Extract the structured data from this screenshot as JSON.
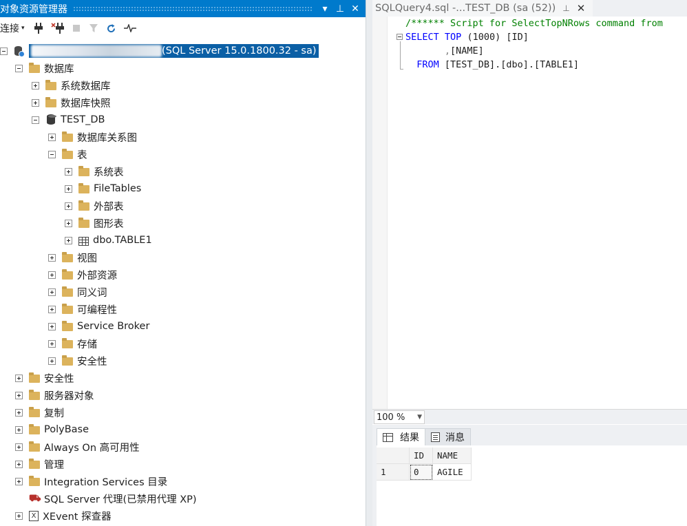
{
  "object_explorer": {
    "title": "对象资源管理器",
    "title_buttons": {
      "dropdown": "▾",
      "pin": "⊥",
      "close": "✕"
    },
    "toolbar": {
      "connect_label": "连接"
    },
    "server_suffix": "(SQL Server 15.0.1800.32 - sa)",
    "tree": {
      "databases": "数据库",
      "system_databases": "系统数据库",
      "database_snapshots": "数据库快照",
      "test_db": "TEST_DB",
      "db_diagrams": "数据库关系图",
      "tables": "表",
      "system_tables": "系统表",
      "filetables": "FileTables",
      "external_tables": "外部表",
      "graph_tables": "图形表",
      "table1": "dbo.TABLE1",
      "views": "视图",
      "external_resources": "外部资源",
      "synonyms": "同义词",
      "programmability": "可编程性",
      "service_broker": "Service Broker",
      "storage": "存储",
      "db_security": "安全性",
      "security": "安全性",
      "server_objects": "服务器对象",
      "replication": "复制",
      "polybase": "PolyBase",
      "always_on": "Always On 高可用性",
      "management": "管理",
      "integration_services": "Integration Services 目录",
      "sql_agent": "SQL Server 代理(已禁用代理 XP)",
      "xevent": "XEvent 探查器"
    }
  },
  "document": {
    "tab_title": "SQLQuery4.sql -...TEST_DB (sa (52))",
    "tab_pin": "⊥",
    "tab_close": "✕",
    "code": {
      "l1_comment": "/****** Script for SelectTopNRows command from",
      "l2_select": "SELECT",
      "l2_top": "TOP",
      "l2_paren": "(1000)",
      "l2_id": "[ID]",
      "l3_comma": ",",
      "l3_name": "[NAME]",
      "l4_from": "FROM",
      "l4_obj": "[TEST_DB].[dbo].[TABLE1]"
    },
    "zoom": "100 %",
    "result_tabs": {
      "results": "结果",
      "messages": "消息"
    },
    "grid": {
      "columns": [
        "ID",
        "NAME"
      ],
      "rows": [
        {
          "rownum": "1",
          "id": "0",
          "name": "AGILE"
        }
      ]
    }
  }
}
